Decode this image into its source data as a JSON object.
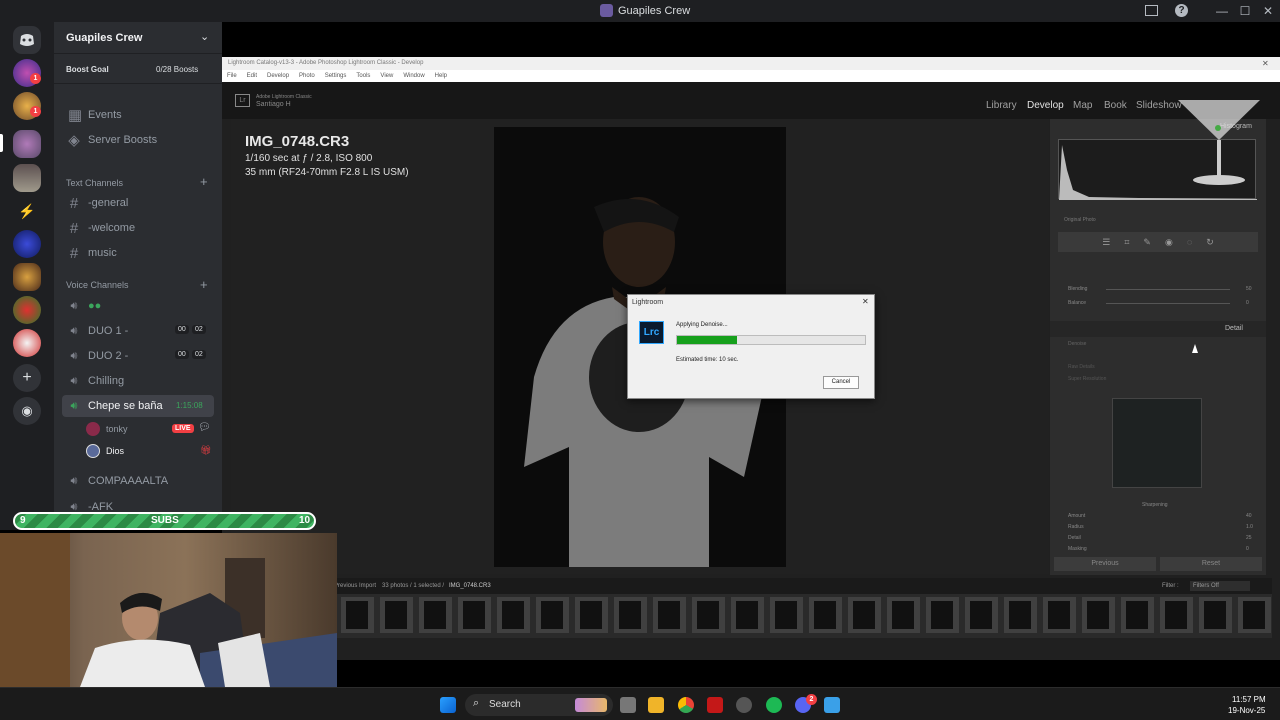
{
  "window": {
    "title": "Guapiles Crew"
  },
  "discord": {
    "server_name": "Guapiles Crew",
    "boost": {
      "label": "Boost Goal",
      "count": "0/28 Boosts"
    },
    "menu": [
      {
        "label": "Events"
      },
      {
        "label": "Server Boosts"
      }
    ],
    "text_category": "Text Channels",
    "text_channels": [
      {
        "label": "-general"
      },
      {
        "label": "-welcome"
      },
      {
        "label": "music"
      }
    ],
    "voice_category": "Voice Channels",
    "voice_channels": [
      {
        "label": "DUO 1 -",
        "c1": "00",
        "c2": "02"
      },
      {
        "label": "DUO 2 -",
        "c1": "00",
        "c2": "02"
      },
      {
        "label": "Chilling"
      },
      {
        "label": "Chepe se baña",
        "time": "1:15:08"
      },
      {
        "label": "COMPAAAALTA"
      },
      {
        "label": "-AFK"
      }
    ],
    "voice_users": [
      {
        "name": "tonky",
        "badge": "LIVE"
      },
      {
        "name": "Dios"
      }
    ],
    "rail_badges": [
      "1",
      "1"
    ]
  },
  "subs": {
    "left": "9",
    "label": "SUBS",
    "right": "10",
    "progress": 0.9
  },
  "lightroom": {
    "window_title": "Lightroom Catalog-v13-3 - Adobe Photoshop Lightroom Classic - Develop",
    "menu": [
      "File",
      "Edit",
      "Develop",
      "Photo",
      "Settings",
      "Tools",
      "View",
      "Window",
      "Help"
    ],
    "brand_line1": "Adobe Lightroom Classic",
    "brand_line2": "Santiago H",
    "modules": [
      "Library",
      "Develop",
      "Map",
      "Book",
      "Slideshow"
    ],
    "active_module": "Develop",
    "photo": {
      "filename": "IMG_0748.CR3",
      "exposure": "1/160 sec at ƒ / 2.8, ISO 800",
      "lens": "35 mm (RF24-70mm F2.8 L IS USM)"
    },
    "panel": {
      "histogram_label": "Histogram",
      "original_photo": "Original Photo",
      "blending": "Blending",
      "blending_val": "50",
      "balance": "Balance",
      "balance_val": "0",
      "detail": "Detail",
      "denoise": "Denoise",
      "raw_details": "Raw Details",
      "super_resolution": "Super Resolution",
      "sharpening": "Sharpening",
      "amount": "Amount",
      "amount_val": "40",
      "radius": "Radius",
      "radius_val": "1.0",
      "detail_s": "Detail",
      "detail_val": "25",
      "masking": "Masking",
      "masking_val": "0",
      "previous": "Previous",
      "reset": "Reset"
    },
    "filmstrip": {
      "source": "Previous Import",
      "info": "33 photos / 1 selected /",
      "file": "IMG_0748.CR3",
      "filter_label": "Filter :",
      "filter_value": "Filters Off"
    },
    "dialog": {
      "title": "Lightroom",
      "logo": "Lrc",
      "status": "Applying Denoise...",
      "progress": 0.32,
      "estimate": "Estimated time: 10 sec.",
      "cancel": "Cancel"
    }
  },
  "taskbar": {
    "search": "Search",
    "time": "11:57 PM",
    "date": "19-Nov-25",
    "discord_badge": "2"
  },
  "colors": {
    "discord_bg": "#2b2d31",
    "active_voice": "#3ba55c",
    "progress": "#16a01c",
    "live": "#f23f43"
  }
}
